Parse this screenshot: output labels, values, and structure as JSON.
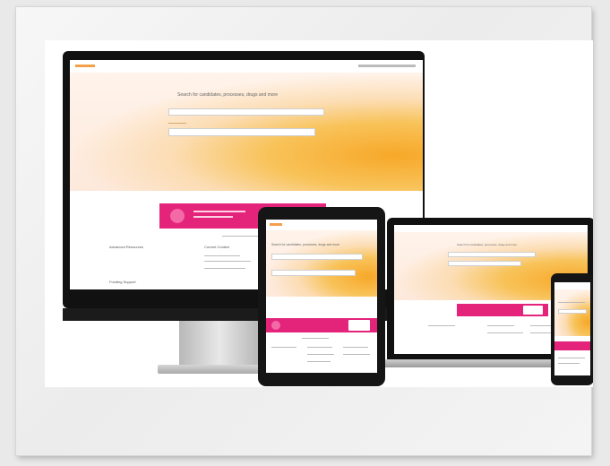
{
  "imac": {
    "hero_heading": "Search for candidates, processes, drugs and more",
    "section_left": "Advanced Resources",
    "section_left2": "Funding Support",
    "section_right": "Current Content"
  },
  "tablet": {
    "hero_heading": "Search for candidates, processes, drugs and more"
  },
  "laptop": {
    "hero_heading": "Search for candidates, processes, drugs and more"
  },
  "colors": {
    "banner": "#e4237b",
    "hero_orange": "#f7a829",
    "device_black": "#111111"
  }
}
